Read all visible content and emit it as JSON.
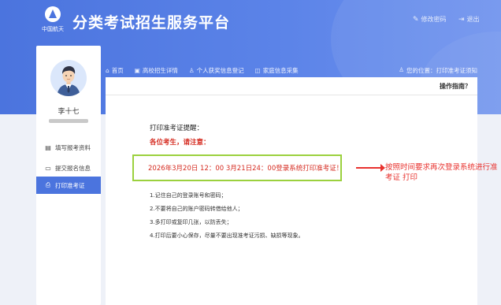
{
  "header": {
    "logo_text": "中国航天",
    "title": "分类考试招生服务平台",
    "change_password": "修改密码",
    "logout": "退出"
  },
  "sidebar": {
    "user_name": "李十七",
    "items": [
      {
        "label": "填写报考资料",
        "icon": "form-icon"
      },
      {
        "label": "提交报名信息",
        "icon": "document-icon"
      },
      {
        "label": "打印准考证",
        "icon": "printer-icon"
      }
    ]
  },
  "topnav": {
    "items": [
      {
        "label": "首页",
        "icon": "home-icon"
      },
      {
        "label": "高校招生详情",
        "icon": "school-icon"
      },
      {
        "label": "个人获奖信息登记",
        "icon": "user-icon"
      },
      {
        "label": "家庭信息采集",
        "icon": "home-info-icon"
      }
    ],
    "location_label": "您的位置：打印准考证须知"
  },
  "content": {
    "help": "操作指南？",
    "notice_title": "打印准考证提醒：",
    "greeting": "各位考生，请注意：",
    "highlight": "2026年3月20日 12：00 3月21日24：00登录系统打印准考证！",
    "tips": [
      "1.记住自己的登录账号和密码；",
      "2.不要将自己的账户密码转借给他人；",
      "3.多打印或复印几张，以防丢失；",
      "4.打印后要小心保存，尽量不要出现准考证污损、缺损等现象。"
    ]
  },
  "annotation": {
    "text": "按照时间要求再次登录系统进行准考证 打印"
  },
  "colors": {
    "header_blue": "#4b74de",
    "active_menu": "#4b74de",
    "alert_red": "#d52a1f",
    "highlight_border": "#9bd13e",
    "annotation_red": "#e8322e"
  }
}
